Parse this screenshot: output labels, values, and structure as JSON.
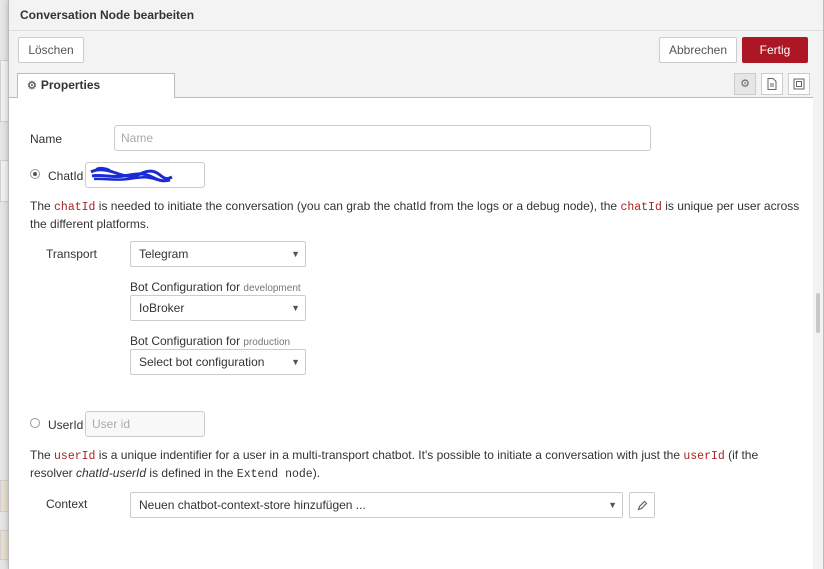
{
  "dialog": {
    "title": "Conversation Node bearbeiten",
    "delete_label": "Löschen",
    "cancel_label": "Abbrechen",
    "done_label": "Fertig"
  },
  "tabs": {
    "properties_label": "Properties",
    "icons": [
      "gear-icon",
      "document-icon",
      "frame-icon"
    ]
  },
  "form": {
    "name_label": "Name",
    "name_placeholder": "Name",
    "chatid_label": "ChatId",
    "chatid_help": {
      "p1": "The ",
      "code1": "chatId",
      "p2": " is needed to initiate the conversation (you can grab the chatId from the logs or a debug node), the ",
      "code2": "chatId",
      "p3": " is unique per user across the different platforms."
    },
    "transport_label": "Transport",
    "transport_value": "Telegram",
    "bot_dev_label": "Bot Configuration for",
    "bot_dev_env": "development",
    "bot_dev_value": "IoBroker",
    "bot_prod_label": "Bot Configuration for",
    "bot_prod_env": "production",
    "bot_prod_value": "Select bot configuration",
    "userid_label": "UserId",
    "userid_placeholder": "User id",
    "userid_help": {
      "p1": "The ",
      "code1": "userId",
      "p2": " is a unique indentifier for a user in a multi-transport chatbot. It's possible to initiate a conversation with just the ",
      "code2": "userId",
      "p3": " (if the resolver ",
      "em1": "chatId-userId",
      "p4": " is defined in the ",
      "code3": "Extend node",
      "p5": ")."
    },
    "context_label": "Context",
    "context_value": "Neuen chatbot-context-store hinzufügen ..."
  },
  "colors": {
    "primary": "#ad1625",
    "code": "#aa2222",
    "scribble": "#1a2bd6"
  }
}
